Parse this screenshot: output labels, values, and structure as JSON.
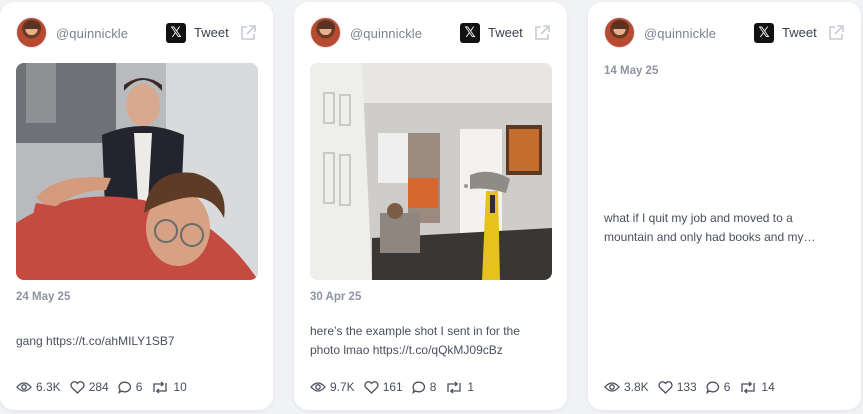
{
  "colors": {
    "page_bg": "#f1f2f6",
    "card_bg": "#ffffff",
    "text": "#4a4f5c",
    "muted": "#8f94a3"
  },
  "tweet_label": "Tweet",
  "cards": [
    {
      "handle": "@quinnickle",
      "date": "24 May 25",
      "text": "gang https://t.co/ahMILY1SB7",
      "has_media": true,
      "stats": {
        "views": "6.3K",
        "likes": "284",
        "replies": "6",
        "retweets": "10"
      }
    },
    {
      "handle": "@quinnickle",
      "date": "30 Apr 25",
      "text": "here’s the example shot I sent in for the photo lmao https://t.co/qQkMJ09cBz",
      "has_media": true,
      "stats": {
        "views": "9.7K",
        "likes": "161",
        "replies": "8",
        "retweets": "1"
      }
    },
    {
      "handle": "@quinnickle",
      "date": "14 May 25",
      "text": "what if I quit my job and moved to a mountain and only had books and my…",
      "has_media": false,
      "stats": {
        "views": "3.8K",
        "likes": "133",
        "replies": "6",
        "retweets": "14"
      }
    }
  ]
}
